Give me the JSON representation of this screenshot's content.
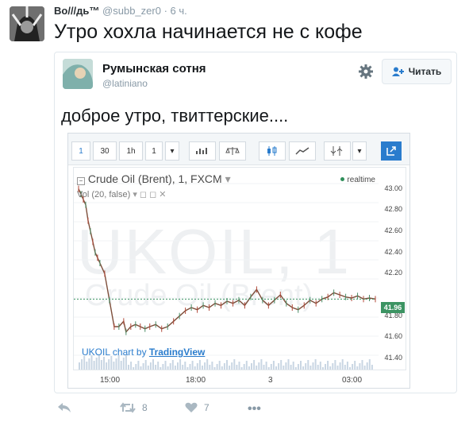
{
  "tweet": {
    "author_name": "Во///дь™",
    "author_handle": "@subb_zer0",
    "time": "6 ч.",
    "text": "Утро хохла начинается не с кофе"
  },
  "quoted": {
    "name": "Румынская сотня",
    "handle": "@latiniano",
    "follow_label": "Читать",
    "text": "доброе утро, твиттерские...."
  },
  "chart": {
    "toolbar": [
      "1",
      "30",
      "1h",
      "1"
    ],
    "symbol_label": "Crude Oil (Brent), 1, FXCM",
    "indicator": "Vol (20, false)",
    "realtime": "realtime",
    "watermark_main": "UKOIL, 1",
    "watermark_sub": "Crude Oil (Brent)",
    "credit_prefix": "UKOIL chart by ",
    "credit_link": "TradingView",
    "last_price": "41.96"
  },
  "chart_data": {
    "type": "line",
    "title": "Crude Oil (Brent), 1, FXCM",
    "y_ticks": [
      "43.00",
      "42.80",
      "42.60",
      "42.40",
      "42.20",
      "41.80",
      "41.60",
      "41.40"
    ],
    "x_ticks": [
      "15:00",
      "18:00",
      "3",
      "03:00"
    ],
    "ylim": [
      41.4,
      43.05
    ],
    "series": [
      {
        "name": "",
        "x": [
          0,
          2,
          4,
          6,
          8,
          10,
          12,
          14,
          16,
          18,
          22,
          26,
          30,
          34,
          38,
          40,
          44,
          48,
          52,
          56,
          60,
          65,
          70,
          75,
          80,
          85,
          90,
          95,
          100,
          105,
          110,
          115,
          120,
          125,
          130,
          135,
          140,
          145,
          150,
          155,
          160,
          165,
          170,
          175,
          180,
          185,
          190,
          195,
          200,
          205,
          210,
          215,
          220,
          225,
          230,
          235,
          240,
          245,
          250
        ],
        "y": [
          43.0,
          42.95,
          42.9,
          42.85,
          42.7,
          42.6,
          42.5,
          42.4,
          42.35,
          42.3,
          42.2,
          41.95,
          41.7,
          41.7,
          41.75,
          41.65,
          41.7,
          41.72,
          41.7,
          41.68,
          41.7,
          41.72,
          41.68,
          41.7,
          41.75,
          41.8,
          41.85,
          41.88,
          41.86,
          41.9,
          41.88,
          41.92,
          41.9,
          41.94,
          41.92,
          41.95,
          41.9,
          41.98,
          42.05,
          41.95,
          41.9,
          41.95,
          42.0,
          41.92,
          41.88,
          41.86,
          41.9,
          41.95,
          41.92,
          41.96,
          41.98,
          42.02,
          42.0,
          41.98,
          41.97,
          41.99,
          41.96,
          41.97,
          41.96
        ]
      }
    ]
  },
  "actions": {
    "retweets": "8",
    "likes": "7"
  },
  "colors": {
    "accent": "#2a7ccd",
    "price_tag": "#3c9463"
  }
}
